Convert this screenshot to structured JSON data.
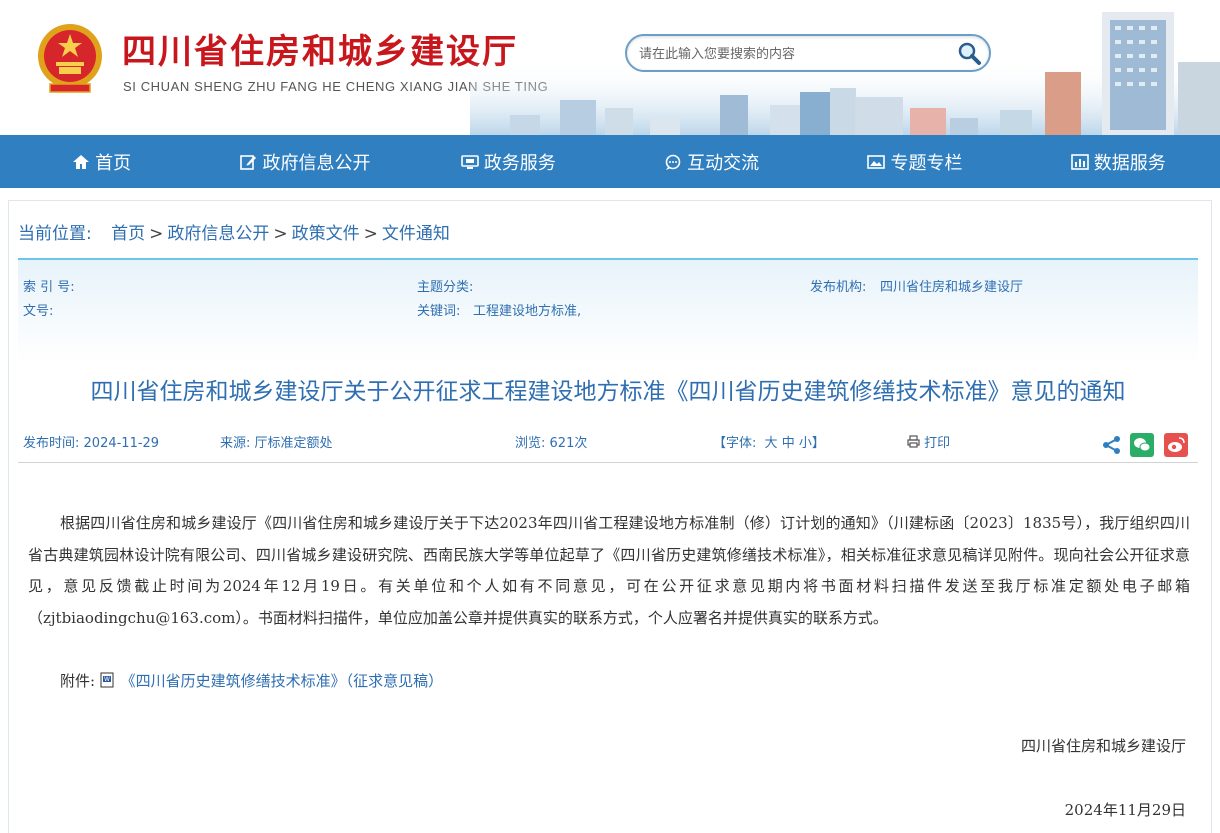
{
  "header": {
    "title": "四川省住房和城乡建设厅",
    "pinyin": "SI CHUAN SHENG ZHU FANG HE CHENG XIANG JIAN SHE TING",
    "emblem_icon": "national-emblem-icon",
    "search_placeholder": "请在此输入您要搜索的内容",
    "search_icon": "search-icon"
  },
  "nav": {
    "items": [
      {
        "label": "首页",
        "icon": "home-icon"
      },
      {
        "label": "政府信息公开",
        "icon": "edit-icon"
      },
      {
        "label": "政务服务",
        "icon": "monitor-icon"
      },
      {
        "label": "互动交流",
        "icon": "chat-icon"
      },
      {
        "label": "专题专栏",
        "icon": "image-icon"
      },
      {
        "label": "数据服务",
        "icon": "chart-icon"
      }
    ]
  },
  "breadcrumb": {
    "label": "当前位置:",
    "items": [
      "首页",
      "政府信息公开",
      "政策文件",
      "文件通知"
    ],
    "separator": ">"
  },
  "meta": {
    "index_label": "索 引 号:",
    "index_value": "",
    "doc_no_label": "文号:",
    "doc_no_value": "",
    "category_label": "主题分类:",
    "category_value": "",
    "keywords_label": "关键词:",
    "keywords_value": "工程建设地方标准,",
    "publisher_label": "发布机构:",
    "publisher_value": "四川省住房和城乡建设厅"
  },
  "document": {
    "title": "四川省住房和城乡建设厅关于公开征求工程建设地方标准《四川省历史建筑修缮技术标准》意见的通知",
    "publish_time_label": "发布时间:",
    "publish_time": "2024-11-29",
    "source_label": "来源:",
    "source": "厅标准定额处",
    "views_label": "浏览:",
    "views": "621次",
    "font_label": "【字体:",
    "font_large": "大",
    "font_medium": "中",
    "font_small": "小",
    "font_close": "】",
    "print_label": "打印",
    "body": "根据四川省住房和城乡建设厅《四川省住房和城乡建设厅关于下达2023年四川省工程建设地方标准制（修）订计划的通知》（川建标函〔2023〕1835号），我厅组织四川省古典建筑园林设计院有限公司、四川省城乡建设研究院、西南民族大学等单位起草了《四川省历史建筑修缮技术标准》，相关标准征求意见稿详见附件。现向社会公开征求意见，意见反馈截止时间为2024年12月19日。有关单位和个人如有不同意见，可在公开征求意见期内将书面材料扫描件发送至我厅标准定额处电子邮箱（zjtbiaodingchu@163.com）。书面材料扫描件，单位应加盖公章并提供真实的联系方式，个人应署名并提供真实的联系方式。",
    "attachment_label": "附件:",
    "attachment_name": "《四川省历史建筑修缮技术标准》（征求意见稿）",
    "signature_org": "四川省住房和城乡建设厅",
    "signature_date": "2024年11月29日"
  },
  "share_icons": [
    "share-icon",
    "wechat-icon",
    "weibo-icon"
  ],
  "colors": {
    "brand_red": "#c8161d",
    "nav_blue": "#2f7fc1",
    "link_blue": "#2f6fb1",
    "wechat_green": "#2aae67",
    "weibo_red": "#e6504d"
  }
}
